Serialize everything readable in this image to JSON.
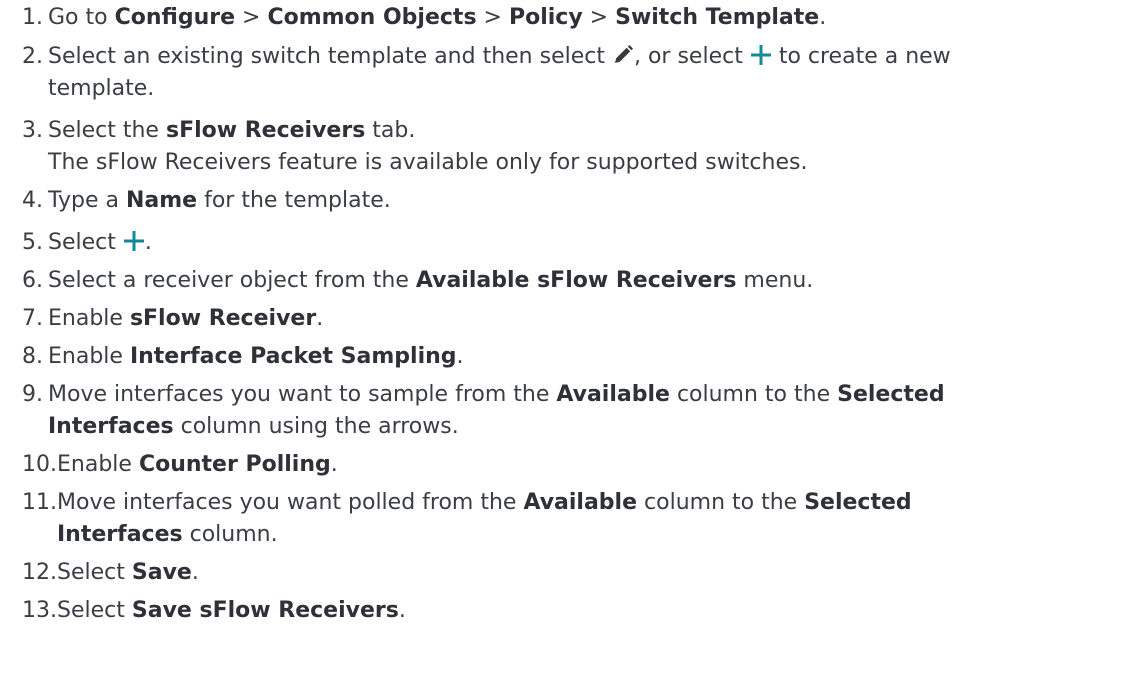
{
  "colors": {
    "text": "#3b3d45",
    "bold_text": "#2f3138",
    "icon_plus": "#138a99",
    "icon_pencil": "#3a3a3a"
  },
  "steps": [
    {
      "num": "1.",
      "text": {
        "t1": "Go to ",
        "b1": "Configure",
        "t2": " > ",
        "b2": "Common Objects",
        "t3": " > ",
        "b3": "Policy",
        "t4": " > ",
        "b4": "Switch Template",
        "t5": "."
      }
    },
    {
      "num": "2.",
      "text": {
        "t1": "Select an existing switch template and then select ",
        "icon1": "pencil-icon",
        "t2": ", or select ",
        "icon2": "plus-icon",
        "t3": " to create a new",
        "t4": "template."
      }
    },
    {
      "num": "3.",
      "text": {
        "t1": "Select the ",
        "b1": "sFlow Receivers",
        "t2": " tab.",
        "note": "The sFlow Receivers feature is available only for supported switches."
      }
    },
    {
      "num": "4.",
      "text": {
        "t1": "Type a ",
        "b1": "Name",
        "t2": " for the template."
      }
    },
    {
      "num": "5.",
      "text": {
        "t1": "Select ",
        "icon1": "plus-icon",
        "t2": "."
      }
    },
    {
      "num": "6.",
      "text": {
        "t1": "Select a receiver object from the ",
        "b1": "Available sFlow Receivers",
        "t2": " menu."
      }
    },
    {
      "num": "7.",
      "text": {
        "t1": "Enable ",
        "b1": "sFlow Receiver",
        "t2": "."
      }
    },
    {
      "num": "8.",
      "text": {
        "t1": "Enable ",
        "b1": "Interface Packet Sampling",
        "t2": "."
      }
    },
    {
      "num": "9.",
      "text": {
        "t1": "Move interfaces you want to sample from the ",
        "b1": "Available",
        "t2": " column to the ",
        "b2": "Selected",
        "b3": "Interfaces",
        "t3": " column using the arrows."
      }
    },
    {
      "num": "10.",
      "text": {
        "t1": "Enable ",
        "b1": "Counter Polling",
        "t2": "."
      }
    },
    {
      "num": "11.",
      "text": {
        "t1": "Move interfaces you want polled from the ",
        "b1": "Available",
        "t2": " column to the ",
        "b2": "Selected",
        "b3": "Interfaces",
        "t3": " column."
      }
    },
    {
      "num": "12.",
      "text": {
        "t1": "Select ",
        "b1": "Save",
        "t2": "."
      }
    },
    {
      "num": "13.",
      "text": {
        "t1": "Select ",
        "b1": "Save sFlow Receivers",
        "t2": "."
      }
    }
  ]
}
